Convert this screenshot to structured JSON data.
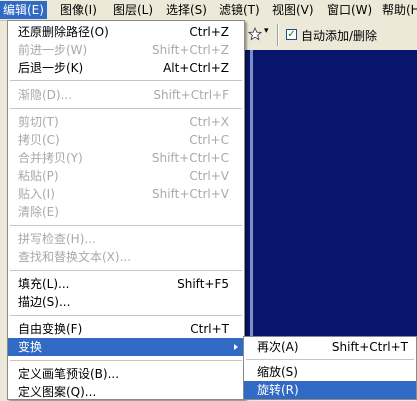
{
  "menubar": {
    "items": [
      "编辑(E)",
      "图像(I)",
      "图层(L)",
      "选择(S)",
      "滤镜(T)",
      "视图(V)",
      "窗口(W)",
      "帮助(H)"
    ]
  },
  "toolbar": {
    "auto_add_remove_label": "自动添加/删除",
    "auto_add_remove_checked": true,
    "dropdown_glyph": "▾"
  },
  "edit_menu": {
    "items": [
      {
        "label": "还原删除路径(O)",
        "shortcut": "Ctrl+Z",
        "enabled": true
      },
      {
        "label": "前进一步(W)",
        "shortcut": "Shift+Ctrl+Z",
        "enabled": false
      },
      {
        "label": "后退一步(K)",
        "shortcut": "Alt+Ctrl+Z",
        "enabled": true
      },
      {
        "label": "渐隐(D)...",
        "shortcut": "Shift+Ctrl+F",
        "enabled": false
      },
      {
        "label": "剪切(T)",
        "shortcut": "Ctrl+X",
        "enabled": false
      },
      {
        "label": "拷贝(C)",
        "shortcut": "Ctrl+C",
        "enabled": false
      },
      {
        "label": "合并拷贝(Y)",
        "shortcut": "Shift+Ctrl+C",
        "enabled": false
      },
      {
        "label": "粘贴(P)",
        "shortcut": "Ctrl+V",
        "enabled": false
      },
      {
        "label": "贴入(I)",
        "shortcut": "Shift+Ctrl+V",
        "enabled": false
      },
      {
        "label": "清除(E)",
        "shortcut": "",
        "enabled": false
      },
      {
        "label": "拼写检查(H)...",
        "shortcut": "",
        "enabled": false
      },
      {
        "label": "查找和替换文本(X)...",
        "shortcut": "",
        "enabled": false
      },
      {
        "label": "填充(L)...",
        "shortcut": "Shift+F5",
        "enabled": true
      },
      {
        "label": "描边(S)...",
        "shortcut": "",
        "enabled": true
      },
      {
        "label": "自由变换(F)",
        "shortcut": "Ctrl+T",
        "enabled": true
      },
      {
        "label": "变换",
        "shortcut": "",
        "enabled": true,
        "highlighted": true,
        "has_submenu": true
      },
      {
        "label": "定义画笔预设(B)...",
        "shortcut": "",
        "enabled": true
      },
      {
        "label": "定义图案(Q)...",
        "shortcut": "",
        "enabled": true
      }
    ]
  },
  "transform_submenu": {
    "items": [
      {
        "label": "再次(A)",
        "shortcut": "Shift+Ctrl+T"
      },
      {
        "label": "缩放(S)",
        "shortcut": ""
      },
      {
        "label": "旋转(R)",
        "shortcut": "",
        "highlighted": true
      }
    ]
  },
  "colors": {
    "highlight": "#316ac5",
    "canvas": "#08156b",
    "menu_bg": "#ffffff",
    "chrome": "#ece9d8",
    "disabled_text": "#a9a9a9"
  }
}
